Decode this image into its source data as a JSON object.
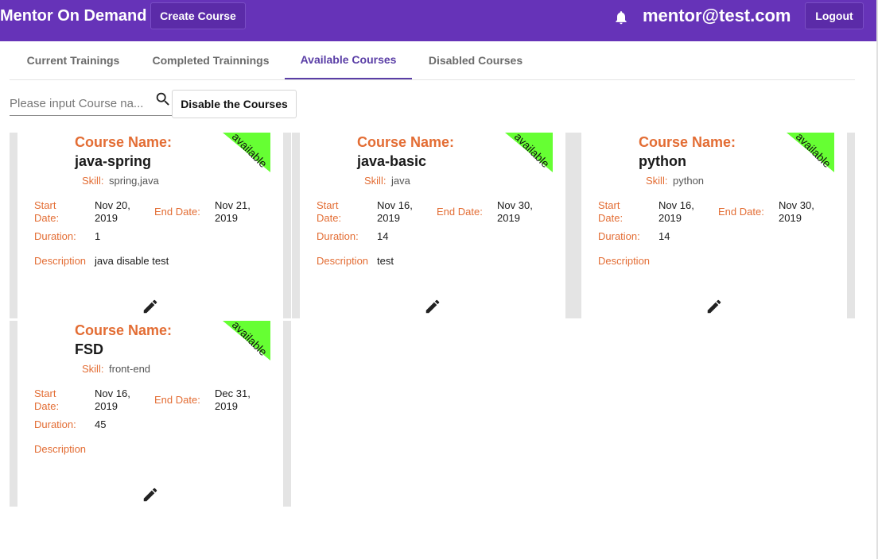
{
  "header": {
    "brand": "Mentor On Demand",
    "create_course_label": "Create Course",
    "notification_icon": "bell-icon",
    "user_email": "mentor@test.com",
    "logout_label": "Logout"
  },
  "tabs": [
    {
      "label": "Current Trainings",
      "active": false
    },
    {
      "label": "Completed Trainnings",
      "active": false
    },
    {
      "label": "Available Courses",
      "active": true
    },
    {
      "label": "Disabled Courses",
      "active": false
    }
  ],
  "toolbar": {
    "search_placeholder": "Please input Course na...",
    "search_icon": "search-icon",
    "disable_button_label": "Disable the Courses"
  },
  "card_labels": {
    "course_name": "Course Name:",
    "skill": "Skill:",
    "start_date": "Start Date:",
    "end_date": "End Date:",
    "duration": "Duration:",
    "description": "Description"
  },
  "courses": [
    {
      "status": "available",
      "name": "java-spring",
      "skill": "spring,java",
      "start_date": "Nov 20, 2019",
      "end_date": "Nov 21, 2019",
      "duration": "1",
      "description": "java disable test"
    },
    {
      "status": "available",
      "name": "java-basic",
      "skill": "java",
      "start_date": "Nov 16, 2019",
      "end_date": "Nov 30, 2019",
      "duration": "14",
      "description": "test"
    },
    {
      "status": "available",
      "name": "python",
      "skill": "python",
      "start_date": "Nov 16, 2019",
      "end_date": "Nov 30, 2019",
      "duration": "14",
      "description": ""
    },
    {
      "status": "available",
      "name": "FSD",
      "skill": "front-end",
      "start_date": "Nov 16, 2019",
      "end_date": "Dec 31, 2019",
      "duration": "45",
      "description": ""
    }
  ],
  "colors": {
    "header_bg": "#6633b8",
    "accent": "#5a3ea6",
    "label": "#e36d34",
    "ribbon": "#66ff33"
  }
}
